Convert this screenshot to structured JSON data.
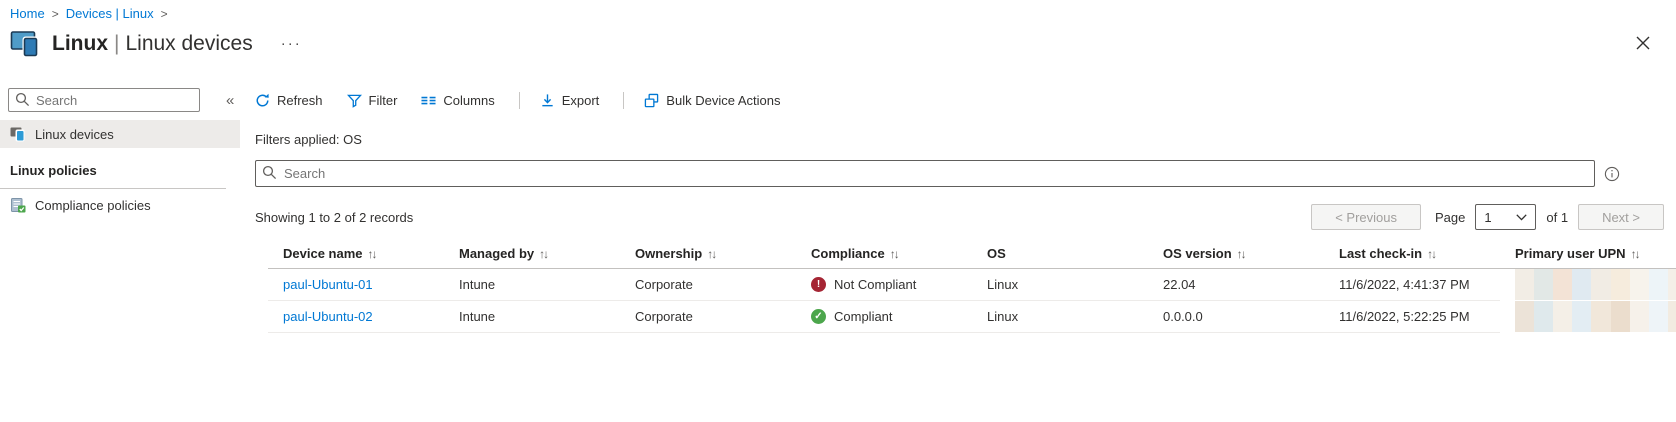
{
  "breadcrumb": {
    "separator": ">",
    "items": [
      {
        "label": "Home"
      },
      {
        "label": "Devices | Linux"
      }
    ]
  },
  "header": {
    "title": "Linux",
    "title_separator": "|",
    "subtitle": "Linux devices",
    "more_glyph": "···"
  },
  "sidebar": {
    "search_placeholder": "Search",
    "collapse_glyph": "«",
    "selected_item": "Linux devices",
    "section_label": "Linux policies",
    "links": [
      {
        "label": "Compliance policies"
      }
    ]
  },
  "toolbar": {
    "items": [
      {
        "label": "Refresh"
      },
      {
        "label": "Filter"
      },
      {
        "label": "Columns"
      },
      {
        "label": "Export"
      },
      {
        "label": "Bulk Device Actions"
      }
    ]
  },
  "filters_bar": {
    "text": "Filters applied: OS"
  },
  "grid_search": {
    "placeholder": "Search"
  },
  "records": {
    "summary": "Showing 1 to 2 of 2 records"
  },
  "pagination": {
    "previous_label": "< Previous",
    "page_label": "Page",
    "current_page": "1",
    "of_label": "of 1",
    "next_label": "Next >"
  },
  "table": {
    "sort_glyph": "↑↓",
    "columns": [
      {
        "label": "Device name",
        "sortable": true
      },
      {
        "label": "Managed by",
        "sortable": true
      },
      {
        "label": "Ownership",
        "sortable": true
      },
      {
        "label": "Compliance",
        "sortable": true
      },
      {
        "label": "OS",
        "sortable": false
      },
      {
        "label": "OS version",
        "sortable": true
      },
      {
        "label": "Last check-in",
        "sortable": true
      },
      {
        "label": "Primary user UPN",
        "sortable": true
      }
    ],
    "status_glyphs": {
      "error": "!",
      "success": "✓"
    },
    "rows": [
      {
        "device_name": "paul-Ubuntu-01",
        "managed_by": "Intune",
        "ownership": "Corporate",
        "compliance": "Not Compliant",
        "compliance_status": "error",
        "os": "Linux",
        "os_version": "22.04",
        "last_check_in": "11/6/2022, 4:41:37 PM",
        "primary_user_upn_redacted": true
      },
      {
        "device_name": "paul-Ubuntu-02",
        "managed_by": "Intune",
        "ownership": "Corporate",
        "compliance": "Compliant",
        "compliance_status": "success",
        "os": "Linux",
        "os_version": "0.0.0.0",
        "last_check_in": "11/6/2022, 5:22:25 PM",
        "primary_user_upn_redacted": true
      }
    ]
  },
  "colors": {
    "accent": "#0078d4",
    "link": "#0078d4",
    "error": "#a52534",
    "success": "#4ca64c"
  }
}
